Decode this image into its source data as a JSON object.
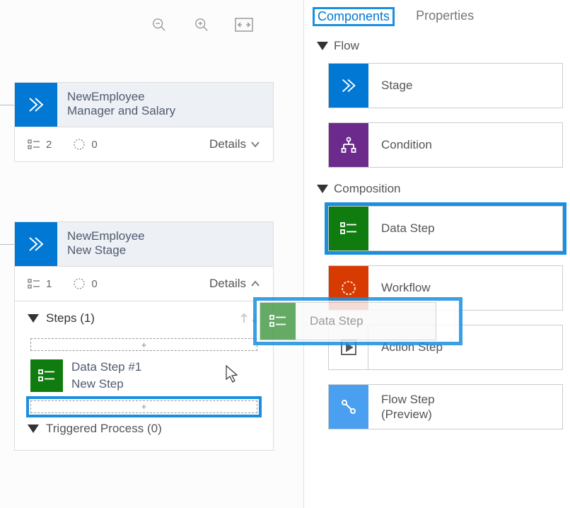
{
  "zoom": {
    "out": "zoom-out",
    "in": "zoom-in",
    "fit": "fit-to-screen"
  },
  "canvas": {
    "stage1": {
      "title": "NewEmployee",
      "subtitle": "Manager and Salary",
      "steps_count": "2",
      "workflow_count": "0",
      "details_label": "Details"
    },
    "stage2": {
      "title": "NewEmployee",
      "subtitle": "New Stage",
      "steps_count": "1",
      "workflow_count": "0",
      "details_label": "Details",
      "steps_header": "Steps (1)",
      "dropzone_plus": "+",
      "step1_title": "Data Step #1",
      "step1_sub": "New Step",
      "triggered_label": "Triggered Process (0)"
    }
  },
  "drag_ghost": {
    "label": "Data Step"
  },
  "panel": {
    "tabs": {
      "components": "Components",
      "properties": "Properties"
    },
    "flow_section": "Flow",
    "composition_section": "Composition",
    "items": {
      "stage": "Stage",
      "condition": "Condition",
      "datastep": "Data Step",
      "workflow": "Workflow",
      "actionstep": "Action Step",
      "flowstep": "Flow Step\n(Preview)"
    }
  }
}
